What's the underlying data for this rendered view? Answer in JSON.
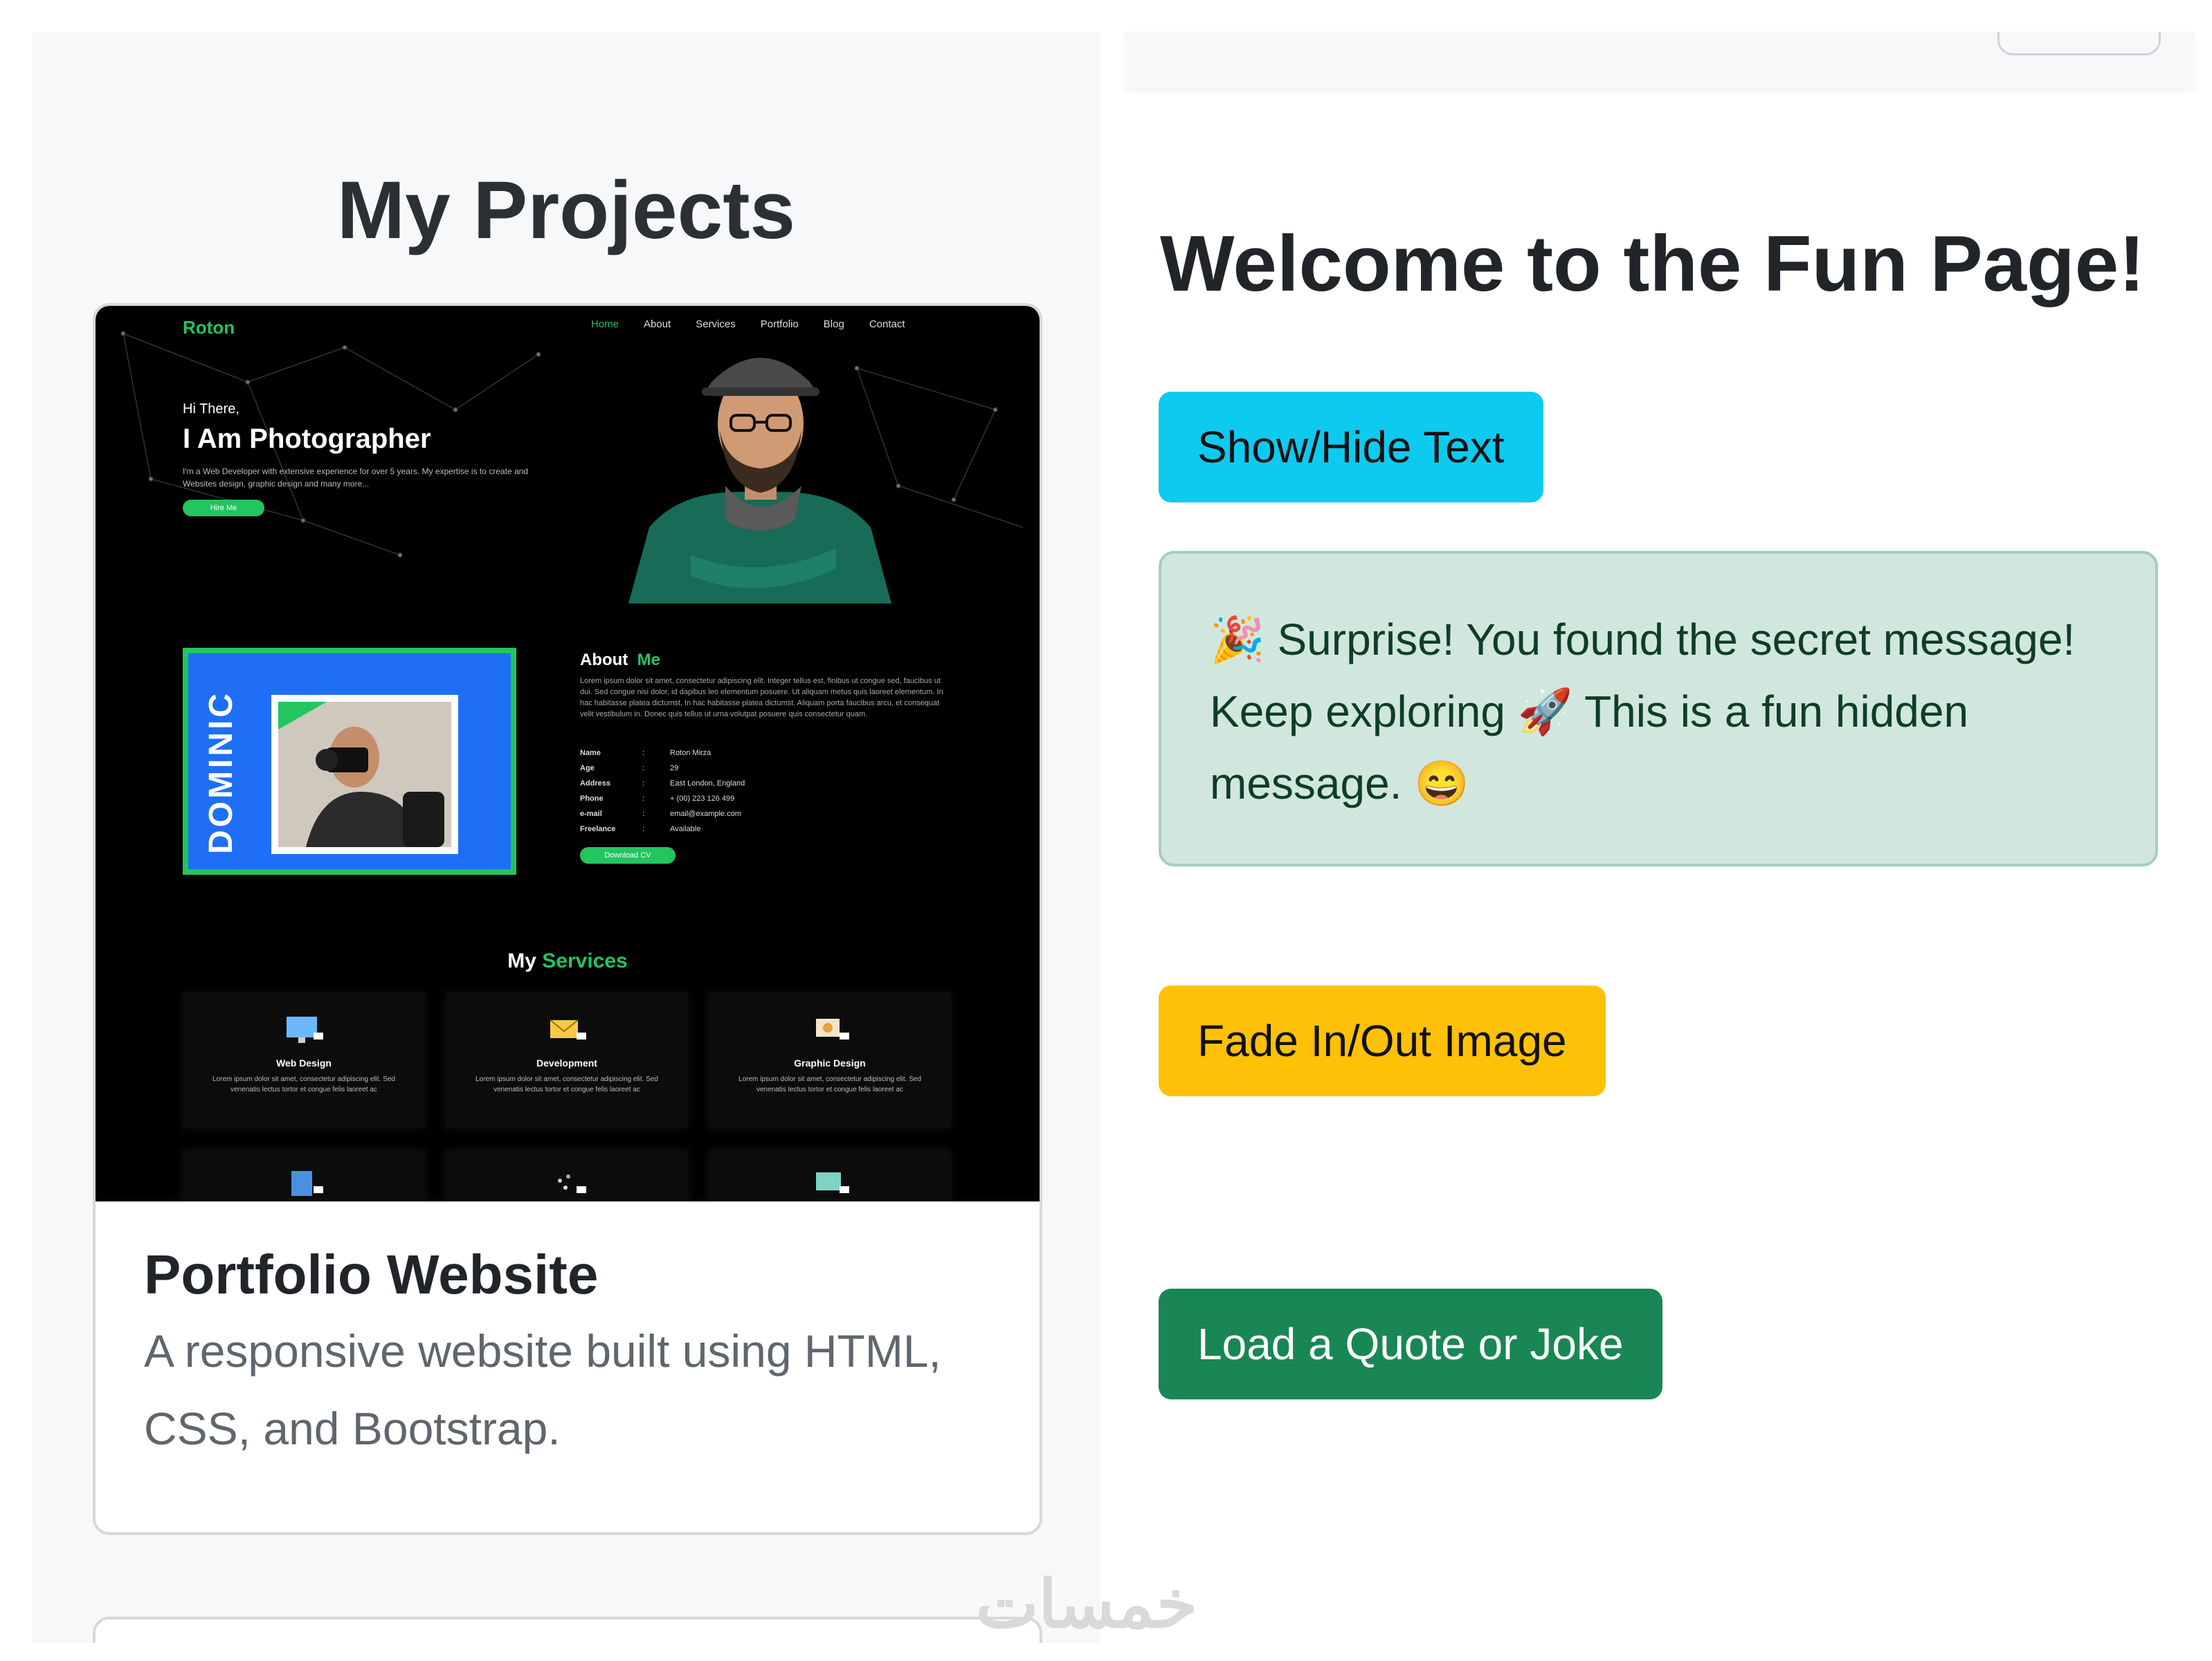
{
  "left": {
    "title": "My Projects",
    "card": {
      "title": "Portfolio Website",
      "description": "A responsive website built using HTML, CSS, and Bootstrap.",
      "preview": {
        "brand": "Roton",
        "nav": [
          "Home",
          "About",
          "Services",
          "Portfolio",
          "Blog",
          "Contact"
        ],
        "hi": "Hi There,",
        "headline": "I Am Photographer",
        "intro": "I'm a Web Developer with extensive experience for over 5 years. My expertise is to create and Websites design, graphic design and many more...",
        "hire_label": "Hire Me",
        "about_title_1": "About",
        "about_title_2": "Me",
        "about_text": "Lorem ipsum dolor sit amet, consectetur adipiscing elit. Integer tellus est, finibus ut congue sed, faucibus ut dui. Sed congue nisi dolor, id dapibus leo elementum posuere. Ut aliquam metus quis laoreet elementum. In hac habitasse platea dictumst. In hac habitasse platea dictumst. Aliquam porta faucibus arcu, et consequat velit vestibulum in. Donec quis tellus ut urna volutpat posuere quis consectetur quam.",
        "dominic": "DOMINIC",
        "info": [
          {
            "key": "Name",
            "value": "Roton Mirza"
          },
          {
            "key": "Age",
            "value": "29"
          },
          {
            "key": "Address",
            "value": "East London, England"
          },
          {
            "key": "Phone",
            "value": "+ (00) 223 126 499"
          },
          {
            "key": "e-mail",
            "value": "email@example.com"
          },
          {
            "key": "Freelance",
            "value": "Available"
          }
        ],
        "cv_label": "Download CV",
        "services_title_1": "My",
        "services_title_2": "Services",
        "services": [
          {
            "title": "Web Design",
            "text": "Lorem ipsum dolor sit amet, consectetur adipiscing elit. Sed venenatis lectus tortor et congue felis laoreet ac"
          },
          {
            "title": "Development",
            "text": "Lorem ipsum dolor sit amet, consectetur adipiscing elit. Sed venenatis lectus tortor et congue felis laoreet ac"
          },
          {
            "title": "Graphic Design",
            "text": "Lorem ipsum dolor sit amet, consectetur adipiscing elit. Sed venenatis lectus tortor et congue felis laoreet ac"
          }
        ]
      }
    }
  },
  "right": {
    "title": "Welcome to the Fun Page!",
    "show_hide_label": "Show/Hide Text",
    "alert_message": "🎉 Surprise! You found the secret message! Keep exploring 🚀 This is a fun hidden message. 😄",
    "fade_label": "Fade In/Out Image",
    "quote_label": "Load a Quote or Joke"
  },
  "watermark": "خمسات",
  "colors": {
    "info": "#0dcaf0",
    "warning": "#ffc107",
    "success": "#198754",
    "alert_bg": "#d1e7dd",
    "accent_green": "#22c55e"
  }
}
